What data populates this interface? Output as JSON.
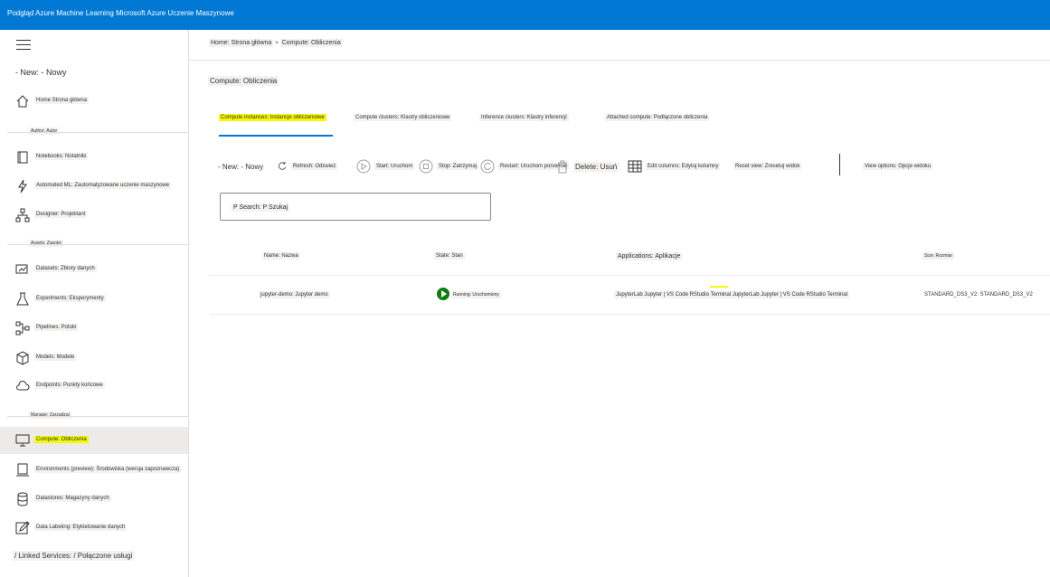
{
  "topbar": {
    "title": "Podgląd Azure Machine Learning Microsoft Azure Uczenie Maszynowe"
  },
  "sidebar": {
    "new_label": "- New: - Nowy",
    "home": "Home Strona główna",
    "author_header": "Author: Autor",
    "notebooks": "Notebooks: Notatniki",
    "automl": "Automated ML: Zautomatyzowane uczenie maszynowe",
    "designer": "Designer: Projektant",
    "assets_header": "Assets: Zasoby",
    "datasets": "Datasets: Zbiory danych",
    "experiments": "Experiments: Eksperymenty",
    "pipelines": "Pipelines: Potoki",
    "models": "Models: Modele",
    "endpoints": "Endpoints: Punkty końcowe",
    "manage_header": "Manage: Zarządzaj",
    "compute": "Compute: Obliczenia",
    "environments": "Environments (preview): Środowiska (wersja zapoznawcza)",
    "datastores": "Datastores: Magazyny danych",
    "labeling": "Data Labeling: Etykietowanie danych",
    "linked_services": "/ Linked Services: / Połączone usługi"
  },
  "breadcrumb": {
    "home": "Home: Strona główna",
    "sep": ">",
    "current": "Compute: Obliczenia"
  },
  "page_title": "Compute: Obliczenia",
  "tabs": [
    "Compute instances: Instancje obliczeniowe",
    "Compute clusters: Klastry obliczeniowe",
    "Inference clusters: Klastry inferencji",
    "Attached compute: Podłączone obliczenia"
  ],
  "toolbar": {
    "new": "- New: - Nowy",
    "refresh": "Refresh: Odśwież",
    "start": "Start: Uruchom",
    "stop": "Stop: Zatrzymaj",
    "restart": "Restart: Uruchom ponownie",
    "delete": "Delete: Usuń",
    "edit_columns": "Edit columns: Edytuj kolumny",
    "reset_view": "Reset view: Zresetuj widok",
    "view_options": "View options: Opcje widoku"
  },
  "search": {
    "placeholder": "P Search: P Szukaj"
  },
  "table": {
    "headers": [
      "Name: Nazwa",
      "State: Stan",
      "Applications: Aplikacje",
      "Size: Rozmiar"
    ],
    "rows": [
      {
        "name": "jupyter-demo: Jupyter demo",
        "state": "Running: Uruchomiony",
        "applications": "JupyterLab Jupyter | VS Code RStudio Terminal JupyterLab Jupyter | VS Code RStudio Terminal",
        "size": "STANDARD_DS3_V2: STANDARD_DS3_V2"
      }
    ]
  },
  "colors": {
    "accent": "#0078d4",
    "highlight": "#f3f90a",
    "running": "#107c10"
  }
}
